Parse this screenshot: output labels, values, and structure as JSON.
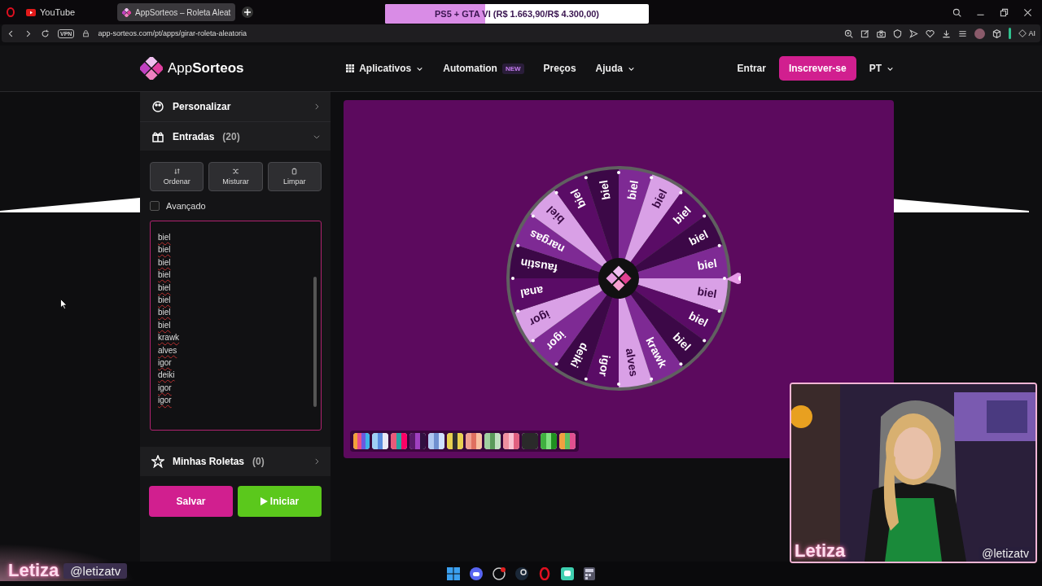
{
  "browser": {
    "tabs": [
      {
        "label": "YouTube",
        "selected": false
      },
      {
        "label": "AppSorteos – Roleta Aleat",
        "selected": true
      }
    ],
    "vpn": "VPN",
    "url": "app-sorteos.com/pt/apps/girar-roleta-aleatoria",
    "ai": "AI"
  },
  "goal": {
    "text": "PS5 + GTA VI (R$ 1.663,90/R$ 4.300,00)",
    "level": 0.38
  },
  "header": {
    "logo": "App**Sorteos**",
    "nav": [
      {
        "label": "Aplicativos",
        "kind": "apps"
      },
      {
        "label": "Automation",
        "kind": "badge",
        "badge": "NEW"
      },
      {
        "label": "Preços",
        "kind": "link"
      },
      {
        "label": "Ajuda",
        "kind": "menu"
      }
    ],
    "login": "Entrar",
    "signup": "Inscrever-se",
    "language": "PT"
  },
  "sidebar": {
    "sections": [
      {
        "label": "Personalizar",
        "expanded": false
      },
      {
        "label": "Entradas",
        "count": "(20)",
        "expanded": true
      }
    ],
    "actions": [
      "Ordenar",
      "Misturar",
      "Limpar"
    ],
    "advanced": {
      "label": "Avançado",
      "checked": false
    },
    "entries": [
      "biel",
      "biel",
      "biel",
      "biel",
      "biel",
      "biel",
      "biel",
      "biel",
      "krawk",
      "alves",
      "igor",
      "deiki",
      "igor",
      "igor"
    ],
    "saved": {
      "label": "Minhas Roletas",
      "count": "(0)",
      "expanded": false
    },
    "save": "Salvar",
    "start": "Iniciar"
  },
  "wheel": {
    "segments": [
      {
        "label": "biel",
        "color": "#d9a0e6"
      },
      {
        "label": "biel",
        "color": "#5a0c66"
      },
      {
        "label": "biel",
        "color": "#3c0847"
      },
      {
        "label": "krawk",
        "color": "#7e2a94"
      },
      {
        "label": "alves",
        "color": "#d9a0e6"
      },
      {
        "label": "igor",
        "color": "#5a0c66"
      },
      {
        "label": "deiki",
        "color": "#3c0847"
      },
      {
        "label": "igor",
        "color": "#7e2a94"
      },
      {
        "label": "igor",
        "color": "#d9a0e6"
      },
      {
        "label": "anal",
        "color": "#5a0c66"
      },
      {
        "label": "faustin",
        "color": "#3c0847"
      },
      {
        "label": "nargas",
        "color": "#7e2a94"
      },
      {
        "label": "biel",
        "color": "#d9a0e6"
      },
      {
        "label": "biel",
        "color": "#5a0c66"
      },
      {
        "label": "biel",
        "color": "#3c0847"
      },
      {
        "label": "biel",
        "color": "#7e2a94"
      },
      {
        "label": "biel",
        "color": "#d9a0e6"
      },
      {
        "label": "biel",
        "color": "#5a0c66"
      },
      {
        "label": "biel",
        "color": "#3c0847"
      },
      {
        "label": "biel",
        "color": "#7e2a94"
      }
    ]
  },
  "stream_overlay": {
    "name": "Letiza",
    "handle": "@letizatv"
  },
  "webcam": {
    "name": "Letiza",
    "handle": "@letizatv"
  }
}
